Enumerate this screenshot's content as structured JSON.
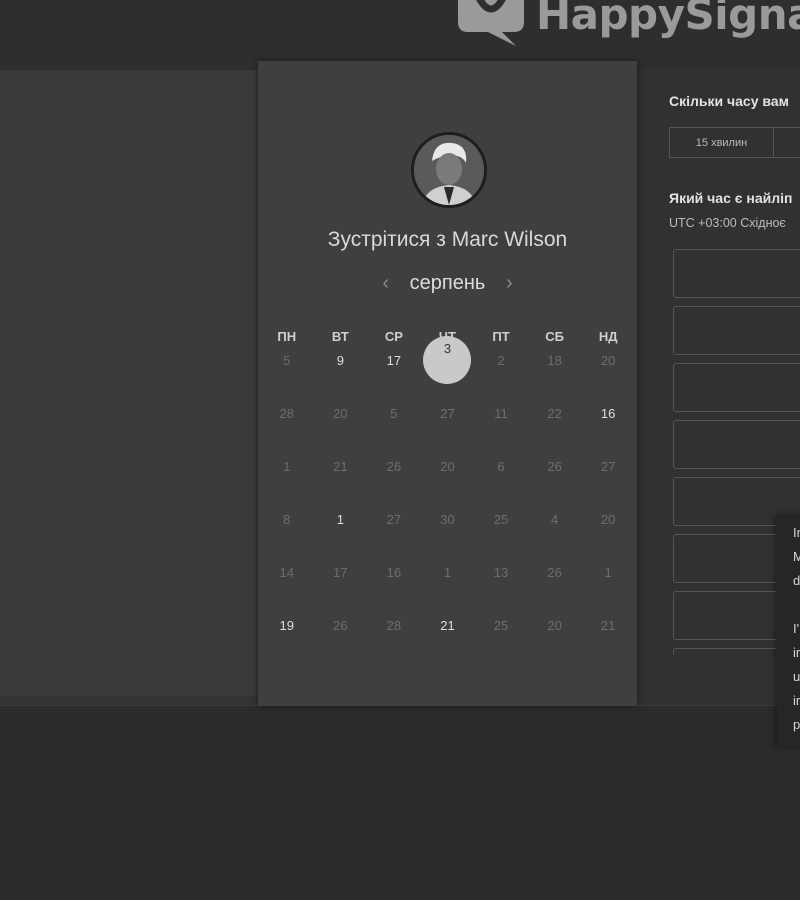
{
  "brand": {
    "name": "HappySignal"
  },
  "calendar": {
    "meet_title": "Зустрітися з Marc Wilson",
    "month": "серпень",
    "prev_arrow": "‹",
    "next_arrow": "›",
    "weekdays": [
      "ПН",
      "ВТ",
      "СР",
      "ЧТ",
      "ПТ",
      "СБ",
      "НД"
    ],
    "weeks": [
      [
        {
          "d": "5",
          "s": "dim"
        },
        {
          "d": "9",
          "s": "avail"
        },
        {
          "d": "17",
          "s": "avail"
        },
        {
          "d": "3",
          "s": "selected"
        },
        {
          "d": "2",
          "s": "dim"
        },
        {
          "d": "18",
          "s": "dim"
        },
        {
          "d": "20",
          "s": "dim"
        }
      ],
      [
        {
          "d": "28",
          "s": "dim"
        },
        {
          "d": "20",
          "s": "dim"
        },
        {
          "d": "5",
          "s": "dim"
        },
        {
          "d": "27",
          "s": "dim"
        },
        {
          "d": "11",
          "s": "dim"
        },
        {
          "d": "22",
          "s": "dim"
        },
        {
          "d": "16",
          "s": "avail"
        }
      ],
      [
        {
          "d": "1",
          "s": "dim"
        },
        {
          "d": "21",
          "s": "dim"
        },
        {
          "d": "26",
          "s": "dim"
        },
        {
          "d": "20",
          "s": "dim"
        },
        {
          "d": "6",
          "s": "dim"
        },
        {
          "d": "26",
          "s": "dim"
        },
        {
          "d": "27",
          "s": "dim"
        }
      ],
      [
        {
          "d": "8",
          "s": "dim"
        },
        {
          "d": "1",
          "s": "avail"
        },
        {
          "d": "27",
          "s": "dim"
        },
        {
          "d": "30",
          "s": "dim"
        },
        {
          "d": "25",
          "s": "dim"
        },
        {
          "d": "4",
          "s": "dim"
        },
        {
          "d": "20",
          "s": "dim"
        }
      ],
      [
        {
          "d": "14",
          "s": "dim"
        },
        {
          "d": "17",
          "s": "dim"
        },
        {
          "d": "16",
          "s": "dim"
        },
        {
          "d": "1",
          "s": "dim"
        },
        {
          "d": "13",
          "s": "dim"
        },
        {
          "d": "26",
          "s": "dim"
        },
        {
          "d": "1",
          "s": "dim"
        }
      ],
      [
        {
          "d": "19",
          "s": "avail"
        },
        {
          "d": "26",
          "s": "dim"
        },
        {
          "d": "28",
          "s": "dim"
        },
        {
          "d": "21",
          "s": "avail"
        },
        {
          "d": "25",
          "s": "dim"
        },
        {
          "d": "20",
          "s": "dim"
        },
        {
          "d": "21",
          "s": "dim"
        }
      ]
    ]
  },
  "scheduler": {
    "duration_question": "Скільки часу вам",
    "duration_options": [
      "15 хвилин",
      "3"
    ],
    "time_question": "Який час є найліп",
    "timezone": "UTC +03:00 Східноє",
    "slot_count": 8
  },
  "tooltip": {
    "lines_a": [
      "In",
      "M",
      "d"
    ],
    "lines_b": [
      "I'",
      "ir",
      "u",
      "ir",
      "p"
    ]
  }
}
